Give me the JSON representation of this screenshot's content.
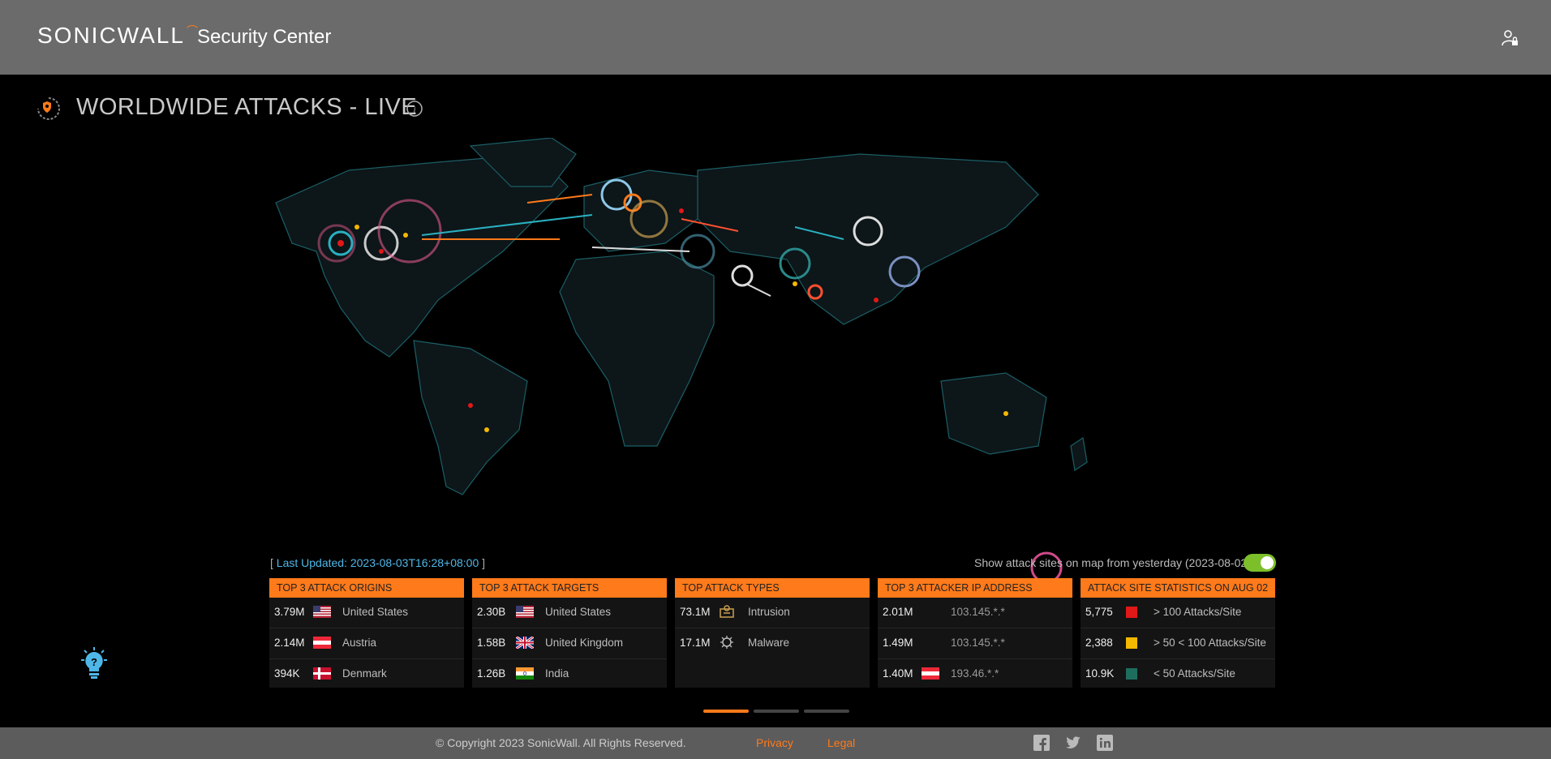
{
  "header": {
    "brand": "SONICWALL",
    "product": "Security Center"
  },
  "title": "WORLDWIDE ATTACKS - LIVE",
  "status": {
    "last_updated": "Last Updated: 2023-08-03T16:28+08:00",
    "toggle_label": "Show attack sites on map from yesterday (2023-08-02)",
    "toggle_on": true
  },
  "panels": {
    "origins": {
      "title": "TOP 3 ATTACK ORIGINS",
      "rows": [
        {
          "value": "3.79M",
          "name": "United States",
          "flag": "us"
        },
        {
          "value": "2.14M",
          "name": "Austria",
          "flag": "at"
        },
        {
          "value": "394K",
          "name": "Denmark",
          "flag": "dk"
        }
      ]
    },
    "targets": {
      "title": "TOP 3 ATTACK TARGETS",
      "rows": [
        {
          "value": "2.30B",
          "name": "United States",
          "flag": "us"
        },
        {
          "value": "1.58B",
          "name": "United Kingdom",
          "flag": "gb"
        },
        {
          "value": "1.26B",
          "name": "India",
          "flag": "in"
        }
      ]
    },
    "types": {
      "title": "TOP ATTACK TYPES",
      "rows": [
        {
          "value": "73.1M",
          "name": "Intrusion",
          "icon": "intrusion-icon"
        },
        {
          "value": "17.1M",
          "name": "Malware",
          "icon": "malware-icon"
        }
      ]
    },
    "ips": {
      "title": "TOP 3 ATTACKER IP ADDRESS",
      "rows": [
        {
          "value": "2.01M",
          "ip": "103.145.*.*"
        },
        {
          "value": "1.49M",
          "ip": "103.145.*.*"
        },
        {
          "value": "1.40M",
          "ip": "193.46.*.*",
          "flag": "at"
        }
      ]
    },
    "sites": {
      "title": "ATTACK SITE STATISTICS ON AUG 02",
      "rows": [
        {
          "value": "5,775",
          "label": "> 100 Attacks/Site",
          "color": "#e01818"
        },
        {
          "value": "2,388",
          "label": "> 50 < 100 Attacks/Site",
          "color": "#f5b800"
        },
        {
          "value": "10.9K",
          "label": "< 50 Attacks/Site",
          "color": "#1e6e5e"
        }
      ]
    }
  },
  "pager": {
    "active_index": 0,
    "count": 3
  },
  "footer": {
    "copyright": "© Copyright 2023 SonicWall. All Rights Reserved.",
    "privacy": "Privacy",
    "legal": "Legal"
  },
  "colors": {
    "accent": "#ff7a1a",
    "header_bg": "#6b6b6b",
    "toggle_on": "#7cbf2a",
    "info": "#4fb7e8"
  }
}
